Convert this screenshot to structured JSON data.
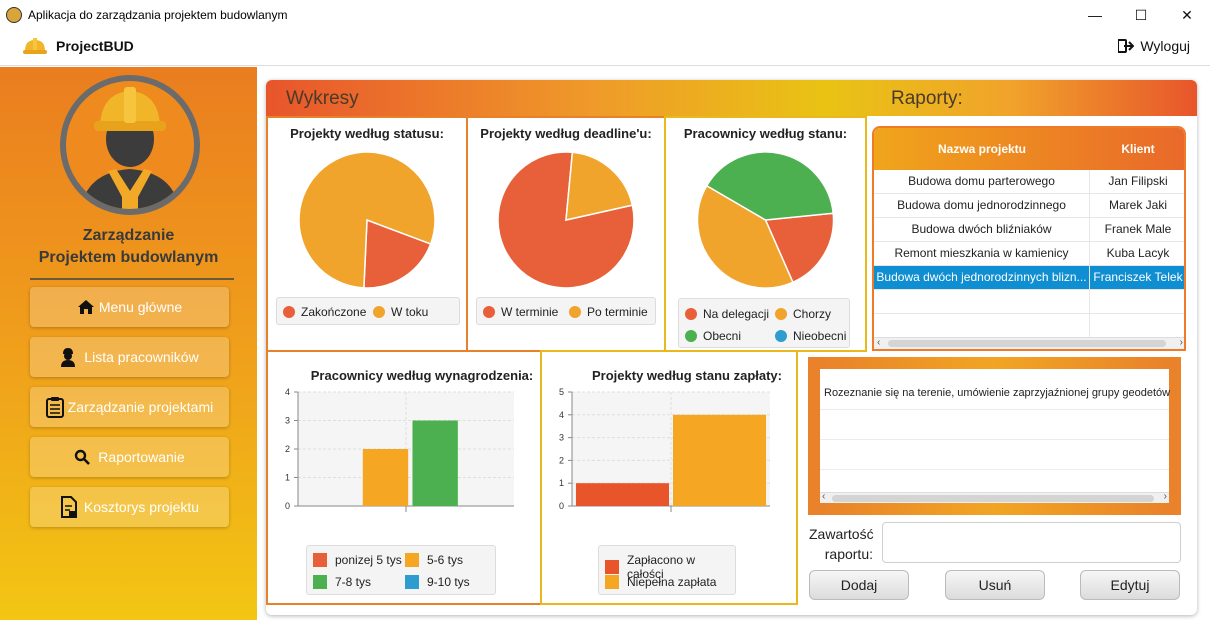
{
  "window": {
    "title": "Aplikacja do zarządzania projektem budowlanym",
    "minimize": "—",
    "maximize": "☐",
    "close": "✕"
  },
  "header": {
    "brand": "ProjectBUD",
    "logout_label": "Wyloguj"
  },
  "sidebar": {
    "title_line1": "Zarządzanie",
    "title_line2": "Projektem budowlanym",
    "items": [
      {
        "label": "Menu główne",
        "icon": "home-icon"
      },
      {
        "label": "Lista pracowników",
        "icon": "worker-icon"
      },
      {
        "label": "Zarządzanie projektami",
        "icon": "clipboard-icon"
      },
      {
        "label": "Raportowanie",
        "icon": "search-icon"
      },
      {
        "label": "Kosztorys projektu",
        "icon": "document-icon"
      }
    ]
  },
  "main": {
    "charts_heading": "Wykresy",
    "reports_heading": "Raporty:"
  },
  "chart_data": [
    {
      "type": "pie",
      "title": "Projekty według statusu:",
      "categories": [
        "Zakończone",
        "W toku"
      ],
      "values": [
        1,
        4
      ],
      "colors": [
        "#e8603a",
        "#f0a42c"
      ]
    },
    {
      "type": "pie",
      "title": "Projekty według deadline'u:",
      "categories": [
        "W terminie",
        "Po terminie"
      ],
      "values": [
        4,
        1
      ],
      "colors": [
        "#e8603a",
        "#f0a42c"
      ]
    },
    {
      "type": "pie",
      "title": "Pracownicy według stanu:",
      "categories": [
        "Na delegacji",
        "Chorzy",
        "Obecni",
        "Nieobecni"
      ],
      "values": [
        1,
        2,
        2,
        0
      ],
      "colors": [
        "#e8603a",
        "#f0a42c",
        "#4caf50",
        "#2e9ccf"
      ]
    },
    {
      "type": "bar",
      "title": "Pracownicy według wynagrodzenia:",
      "series": [
        {
          "name": "ponizej 5 tys",
          "value": 0,
          "color": "#e8603a"
        },
        {
          "name": "5-6 tys",
          "value": 2,
          "color": "#f5a623"
        },
        {
          "name": "7-8 tys",
          "value": 3,
          "color": "#4caf50"
        },
        {
          "name": "9-10 tys",
          "value": 0,
          "color": "#2e9ccf"
        }
      ],
      "ylim": [
        0,
        4
      ],
      "yticks": [
        "0",
        "1",
        "2",
        "3",
        "4"
      ]
    },
    {
      "type": "bar",
      "title": "Projekty według stanu zapłaty:",
      "series": [
        {
          "name": "Zapłacono w całości",
          "value": 1,
          "color": "#e8552b"
        },
        {
          "name": "Niepełna zapłata",
          "value": 4,
          "color": "#f5a623"
        }
      ],
      "ylim": [
        0,
        5
      ],
      "yticks": [
        "0",
        "1",
        "2",
        "3",
        "4",
        "5"
      ]
    }
  ],
  "reports_table": {
    "columns": [
      "Nazwa projektu",
      "Klient"
    ],
    "rows": [
      [
        "Budowa domu parterowego",
        "Jan Filipski"
      ],
      [
        "Budowa domu jednorodzinnego",
        "Marek Jaki"
      ],
      [
        "Budowa dwóch bliźniaków",
        "Franek Male"
      ],
      [
        "Remont mieszkania w kamienicy",
        "Kuba Lacyk"
      ],
      [
        "Budowa dwóch jednorodzinnych blizn...",
        "Franciszek Telek"
      ]
    ],
    "selected_row": 4
  },
  "report_preview": {
    "text": "Rozeznanie się na terenie, umówienie zaprzyjaźnionej grupy geodetów"
  },
  "form": {
    "content_label_line1": "Zawartość",
    "content_label_line2": "raportu:",
    "content_value": "",
    "add": "Dodaj",
    "delete": "Usuń",
    "edit": "Edytuj"
  }
}
